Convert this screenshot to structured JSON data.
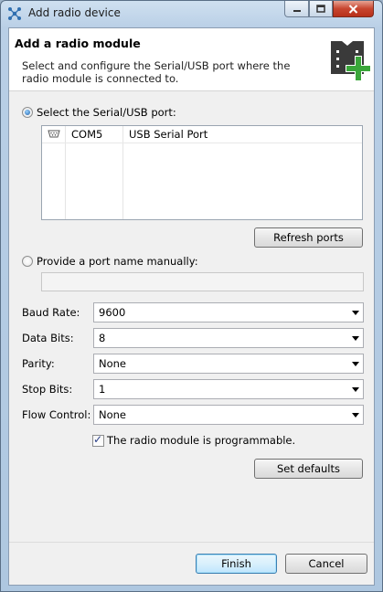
{
  "window": {
    "title": "Add radio device"
  },
  "header": {
    "title": "Add a radio module",
    "description": "Select and configure the Serial/USB port where the radio module is connected to."
  },
  "port_selection": {
    "select_label": "Select the Serial/USB port:",
    "select_checked": true,
    "ports": [
      {
        "name": "COM5",
        "description": "USB Serial Port"
      }
    ],
    "refresh_label": "Refresh ports",
    "manual_label": "Provide a port name manually:",
    "manual_checked": false,
    "manual_value": ""
  },
  "settings": {
    "baud_rate": {
      "label": "Baud Rate:",
      "value": "9600"
    },
    "data_bits": {
      "label": "Data Bits:",
      "value": "8"
    },
    "parity": {
      "label": "Parity:",
      "value": "None"
    },
    "stop_bits": {
      "label": "Stop Bits:",
      "value": "1"
    },
    "flow_control": {
      "label": "Flow Control:",
      "value": "None"
    }
  },
  "programmable": {
    "label": "The radio module is programmable.",
    "checked": true
  },
  "set_defaults_label": "Set defaults",
  "footer": {
    "finish_label": "Finish",
    "cancel_label": "Cancel"
  },
  "colors": {
    "accent_green": "#3aa63a",
    "icon_dark": "#3a3a3a",
    "title_bar": "#b9cfe6"
  }
}
